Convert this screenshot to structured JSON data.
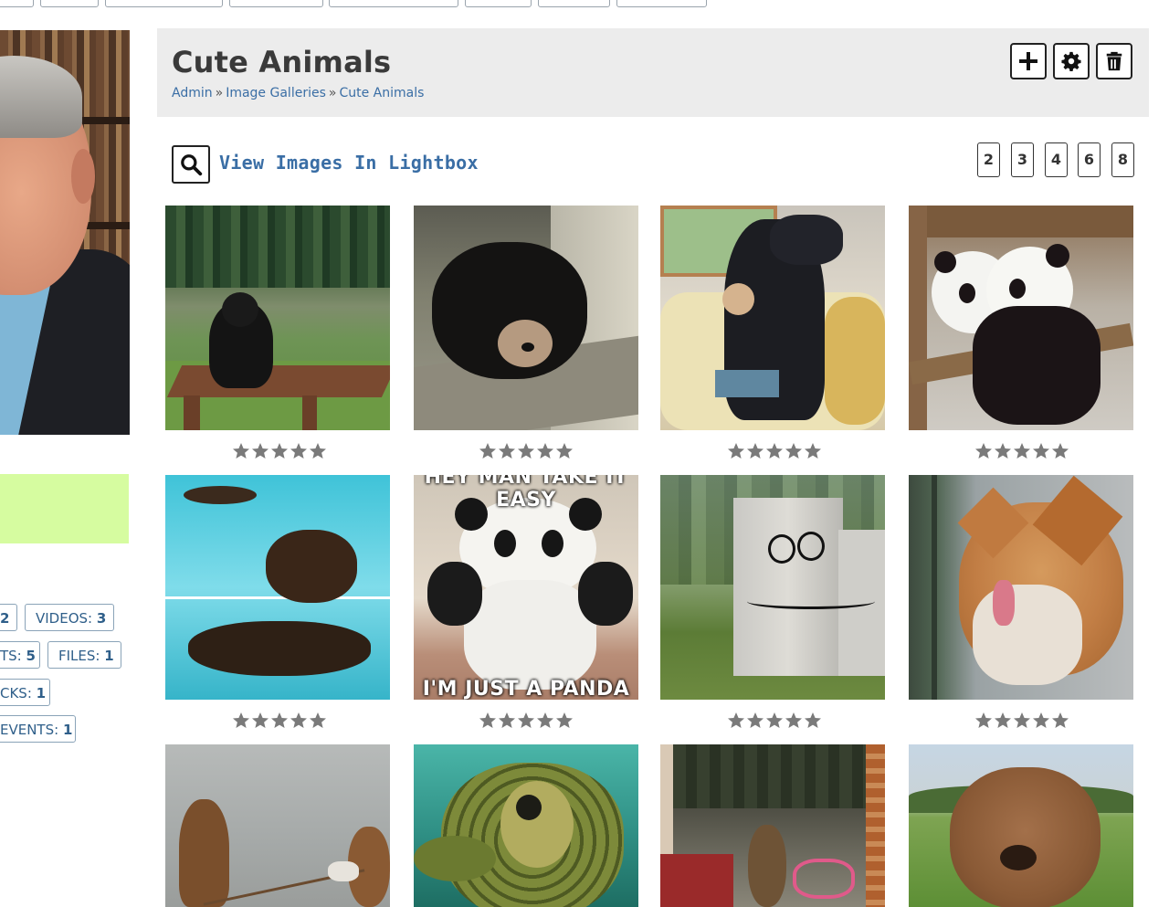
{
  "page": {
    "title": "Cute Animals",
    "breadcrumb": [
      "Admin",
      "Image Galleries",
      "Cute Animals"
    ],
    "breadcrumb_separator": "»"
  },
  "header_actions": {
    "add_icon": "plus-icon",
    "settings_icon": "gear-icon",
    "delete_icon": "trash-icon"
  },
  "lightbox": {
    "label": "View Images In Lightbox",
    "icon": "search-icon"
  },
  "columns": [
    "2",
    "3",
    "4",
    "6",
    "8"
  ],
  "sidebar": {
    "stats": [
      {
        "label": "",
        "count": "2"
      },
      {
        "label": "VIDEOS:",
        "count": "3"
      },
      {
        "label": "TS:",
        "count": "5"
      },
      {
        "label": "FILES:",
        "count": "1"
      },
      {
        "label": "CKS:",
        "count": "1"
      },
      {
        "label": "EVENTS:",
        "count": "1"
      }
    ],
    "highlight_color": "#d6fca0"
  },
  "gallery": {
    "images": [
      {
        "subject": "black bear at picnic table",
        "rating": 0
      },
      {
        "subject": "sun bear resting on log",
        "rating": 0
      },
      {
        "subject": "large dog sitting on woman in chair",
        "rating": 0
      },
      {
        "subject": "two baby pandas hugging",
        "rating": 0
      },
      {
        "subject": "dog swimming in pool",
        "rating": 0,
        "caption": ""
      },
      {
        "subject": "panda meme",
        "rating": 0,
        "caption_top": "HEY MAN TAKE IT EASY",
        "caption_bottom": "I'M JUST A PANDA"
      },
      {
        "subject": "utility box with face drawing",
        "rating": 0
      },
      {
        "subject": "fox licking glass",
        "rating": 0
      },
      {
        "subject": "bear cubs on rope",
        "rating": 0
      },
      {
        "subject": "sea turtle",
        "rating": 0
      },
      {
        "subject": "bear cub in doorway with tricycle",
        "rating": 0
      },
      {
        "subject": "quokka/wombat on grass",
        "rating": 0
      }
    ]
  },
  "colors": {
    "link": "#3a6ea5",
    "header_bg": "#ececec",
    "star": "#7a7a7a"
  }
}
